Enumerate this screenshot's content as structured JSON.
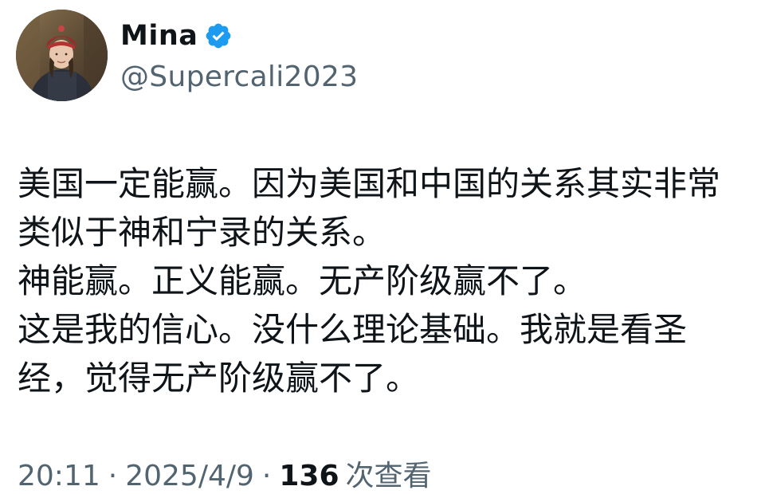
{
  "author": {
    "name": "Mina",
    "handle": "@Supercali2023",
    "verified": true,
    "verified_color": "#1d9bf0"
  },
  "post": {
    "lines": [
      "美国一定能赢。因为美国和中国的关系其实非常",
      "类似于神和宁录的关系。",
      "神能赢。正义能赢。无产阶级赢不了。",
      "这是我的信心。没什么理论基础。我就是看圣",
      "经，觉得无产阶级赢不了。"
    ]
  },
  "meta": {
    "time": "20:11",
    "separator": "·",
    "date": "2025/4/9",
    "views_count": "136",
    "views_label": "次查看"
  },
  "colors": {
    "text": "#0f1419",
    "secondary": "#536471",
    "background": "#ffffff"
  },
  "icons": {
    "avatar": "profile-photo",
    "verified": "verified-badge-icon"
  }
}
